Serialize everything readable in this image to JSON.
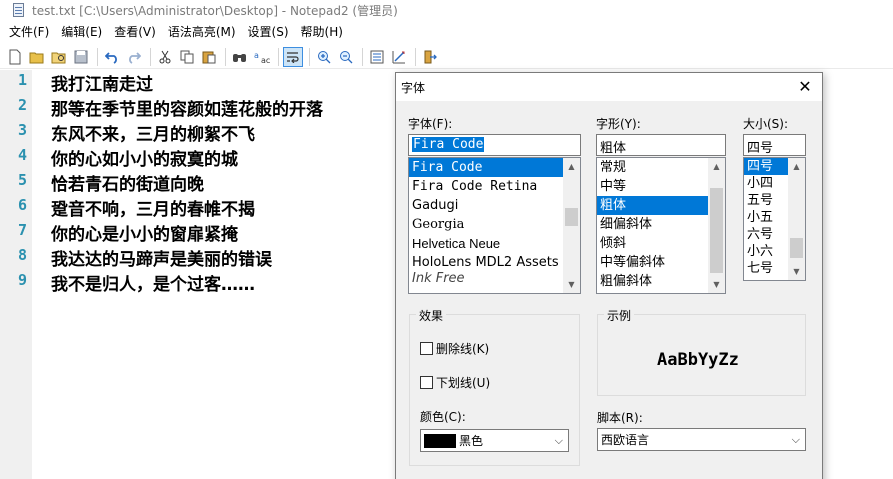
{
  "window": {
    "title": "test.txt [C:\\Users\\Administrator\\Desktop] - Notepad2 (管理员)"
  },
  "menu": [
    "文件(F)",
    "编辑(E)",
    "查看(V)",
    "语法高亮(M)",
    "设置(S)",
    "帮助(H)"
  ],
  "toolbar_icons": [
    "new-file-icon",
    "open-folder-icon",
    "browse-icon",
    "save-icon",
    "undo-icon",
    "redo-icon",
    "cut-icon",
    "copy-icon",
    "paste-icon",
    "find-icon",
    "replace-icon",
    "word-wrap-icon",
    "zoom-in-icon",
    "zoom-out-icon",
    "scheme-icon",
    "customize-icon",
    "exit-icon"
  ],
  "editor": {
    "line_numbers": [
      "1",
      "2",
      "3",
      "4",
      "5",
      "6",
      "7",
      "8",
      "9"
    ],
    "lines": [
      "我打江南走过",
      "那等在季节里的容颜如莲花般的开落",
      "东风不来，三月的柳絮不飞",
      "你的心如小小的寂寞的城",
      "恰若青石的街道向晚",
      "跫音不响，三月的春帷不揭",
      "你的心是小小的窗扉紧掩",
      "我达达的马蹄声是美丽的错误",
      "我不是归人，是个过客……"
    ]
  },
  "dialog": {
    "title": "字体",
    "font_label": "字体(F):",
    "font_value": "Fira Code",
    "font_list": [
      "Fira Code",
      "Fira Code Retina",
      "Gadugi",
      "Georgia",
      "Helvetica Neue",
      "HoloLens MDL2 Assets",
      "Ink Free"
    ],
    "style_label": "字形(Y):",
    "style_value": "粗体",
    "style_list": [
      "常规",
      "中等",
      "粗体",
      "细偏斜体",
      "倾斜",
      "中等偏斜体",
      "粗偏斜体"
    ],
    "size_label": "大小(S):",
    "size_value": "四号",
    "size_list": [
      "四号",
      "小四",
      "五号",
      "小五",
      "六号",
      "小六",
      "七号"
    ],
    "effects_title": "效果",
    "strikeout_label": "删除线(K)",
    "underline_label": "下划线(U)",
    "color_label": "颜色(C):",
    "color_value": "黑色",
    "sample_title": "示例",
    "sample_text": "AaBbYyZz",
    "script_label": "脚本(R):",
    "script_value": "西欧语言"
  },
  "colors": {
    "line_number": "#2b91af",
    "selection": "#0078d7",
    "swatch": "#000000"
  }
}
